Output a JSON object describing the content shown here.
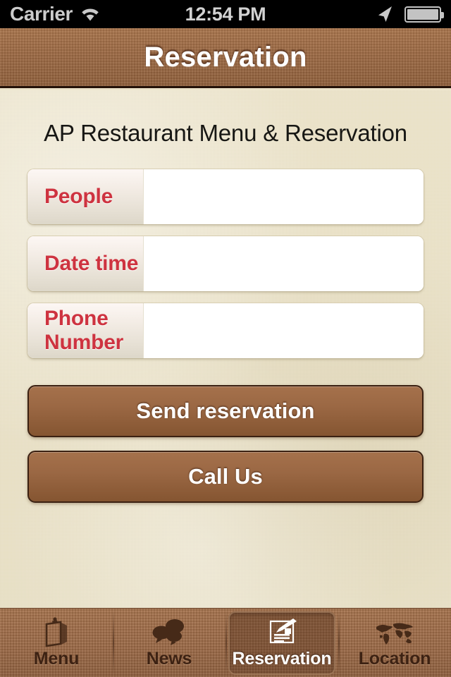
{
  "status_bar": {
    "carrier": "Carrier",
    "time": "12:54 PM",
    "wifi_icon": "wifi-icon",
    "location_icon": "location-arrow-icon",
    "battery_icon": "battery-icon"
  },
  "navbar": {
    "title": "Reservation"
  },
  "main": {
    "subtitle": "AP Restaurant Menu & Reservation",
    "fields": [
      {
        "label": "People",
        "value": "",
        "placeholder": ""
      },
      {
        "label": "Date time",
        "value": "",
        "placeholder": ""
      },
      {
        "label": "Phone Number",
        "value": "",
        "placeholder": ""
      }
    ],
    "buttons": [
      {
        "label": "Send reservation"
      },
      {
        "label": "Call Us"
      }
    ]
  },
  "tabbar": {
    "items": [
      {
        "label": "Menu",
        "icon": "clipboard-icon",
        "active": false
      },
      {
        "label": "News",
        "icon": "speech-bubbles-icon",
        "active": false
      },
      {
        "label": "Reservation",
        "icon": "pen-writing-icon",
        "active": true
      },
      {
        "label": "Location",
        "icon": "world-map-icon",
        "active": false
      }
    ]
  },
  "colors": {
    "accent_red": "#CE3340",
    "brand_brown": "#9B6846",
    "page_background": "#ECE4CA",
    "dark_brown": "#3B2112"
  }
}
